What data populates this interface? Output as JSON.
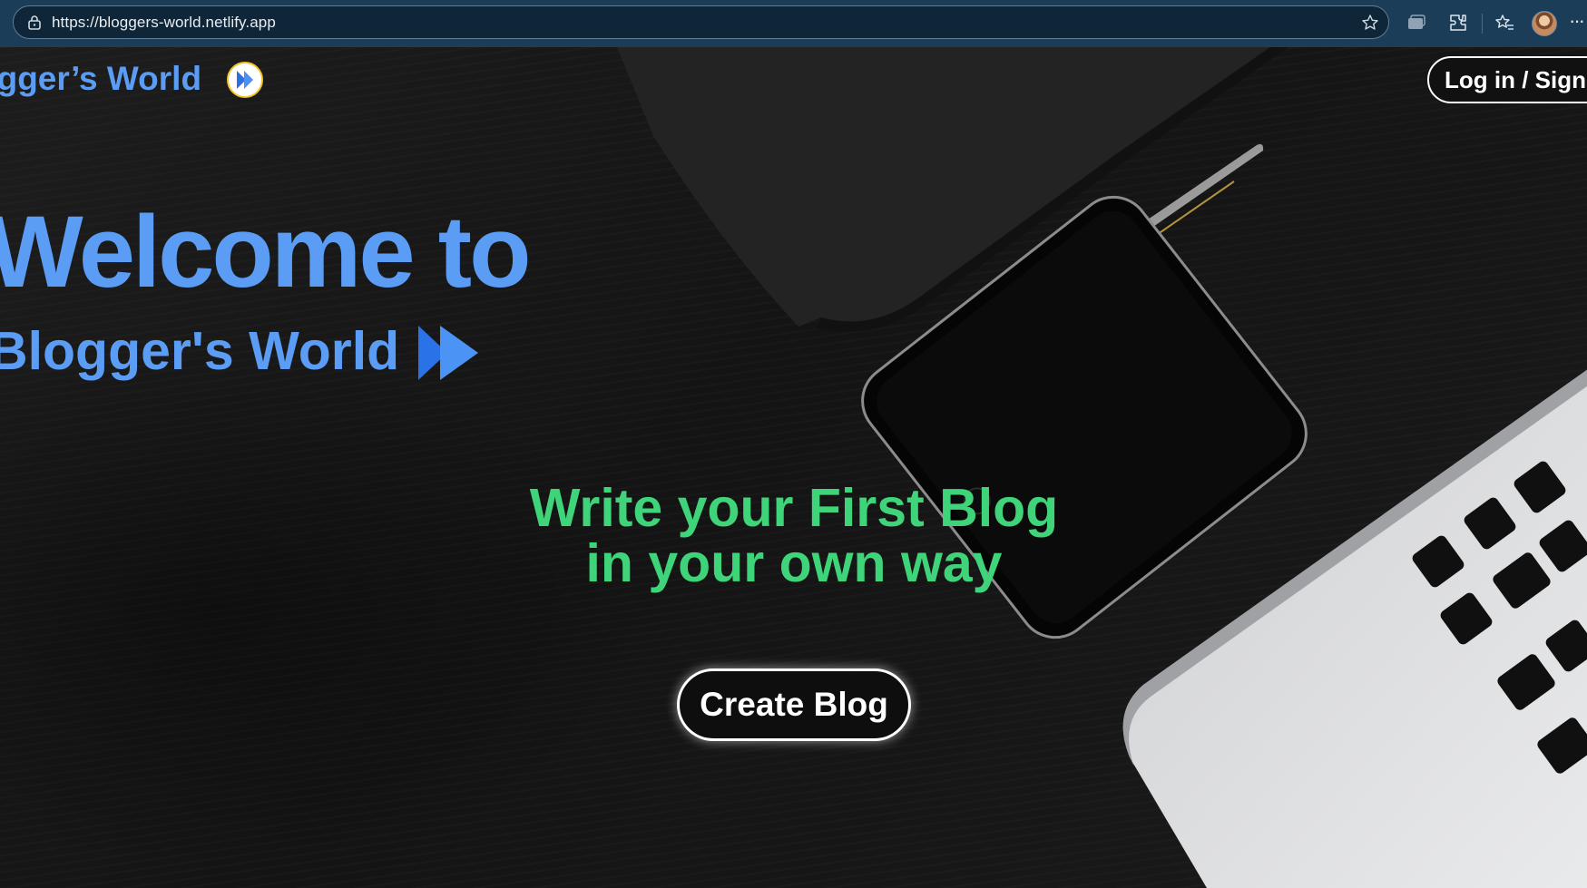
{
  "browser": {
    "url": "https://bloggers-world.netlify.app",
    "icons": [
      "lock-icon",
      "star-icon",
      "tab-collection-icon",
      "extensions-icon",
      "favorites-icon",
      "profile-avatar",
      "more-icon"
    ]
  },
  "nav": {
    "logo_text": "ogger’s World",
    "login_label": "Log in / Sign"
  },
  "hero": {
    "welcome": "Welcome to",
    "brand": "Blogger's World",
    "tagline_line1": "Write your First Blog",
    "tagline_line2": "in your own way",
    "cta_label": "Create Blog"
  },
  "colors": {
    "brand_blue": "#5b9cf5",
    "tagline_green": "#3fd37a",
    "chrome_bg": "#1c3d58"
  }
}
